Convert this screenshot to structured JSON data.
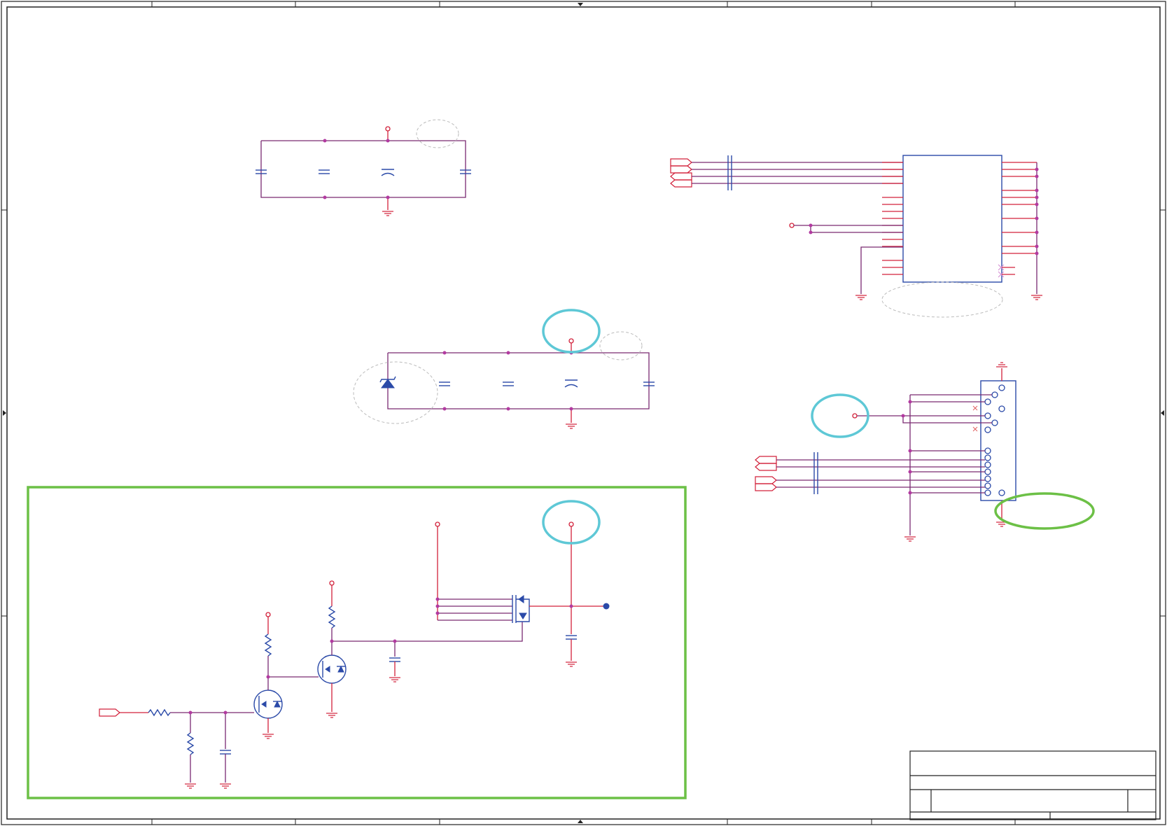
{
  "diagram": {
    "kind": "schematic",
    "colors": {
      "wire": "#d2203a",
      "net": "#7a2a72",
      "component": "#2b4aa8",
      "highlight_cyan": "#5ec8d6",
      "highlight_green": "#6cc046",
      "frame": "#222222"
    },
    "blocks": [
      "decoupling-group-top",
      "decoupling-group-middle",
      "connector-block-ic",
      "connector-block-ports",
      "switch-block"
    ]
  }
}
